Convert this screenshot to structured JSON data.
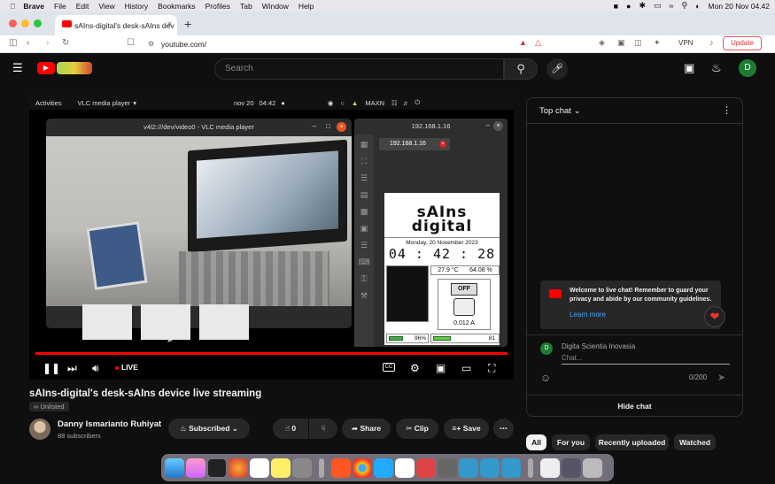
{
  "menubar": {
    "app": "Brave",
    "items": [
      "File",
      "Edit",
      "View",
      "History",
      "Bookmarks",
      "Profiles",
      "Tab",
      "Window",
      "Help"
    ],
    "clock": "Mon 20 Nov  04.42"
  },
  "browser": {
    "tab_title": "sAIns-digital's desk-sAIns dev",
    "url": "youtube.com/",
    "vpn": "VPN",
    "update": "Update"
  },
  "youtube": {
    "search_placeholder": "Search",
    "avatar_letter": "D"
  },
  "player": {
    "activities": "Activities",
    "vlc_menu": "VLC media player",
    "date": "nov 20",
    "time": "04:42",
    "maxn": "MAXN",
    "vlc_title": "v4l2:///dev/video0 - VLC media player",
    "panel_title": "192.168.1.16",
    "panel_tab": "192.168.1.16",
    "live_label": "LIVE",
    "cc_label": "CC"
  },
  "device": {
    "logo_line1": "sAIns",
    "logo_line2": "digital",
    "date": "Monday, 20 November 2023",
    "time": "04 : 42 : 28",
    "temp": "27.9 °C",
    "humidity": "64.08 %",
    "switch_label": "OFF",
    "current": "0.012 A",
    "battery": "96%",
    "signal": "81"
  },
  "video": {
    "title": "sAIns-digital's desk-sAIns device live streaming",
    "visibility": "Unlisted",
    "channel_name": "Danny Ismarianto Ruhiyat",
    "subscribers": "88 subscribers",
    "subscribed_label": "Subscribed",
    "like_count": "0",
    "share_label": "Share",
    "clip_label": "Clip",
    "save_label": "Save"
  },
  "chat": {
    "header": "Top chat",
    "welcome": "Welcome to live chat! Remember to guard your privacy and abide by our community guidelines.",
    "learn_more": "Learn more",
    "user": "Digita Scientia Inovasia",
    "user_initial": "D",
    "input_placeholder": "Chat...",
    "char_count": "0/200",
    "hide_chat": "Hide chat"
  },
  "chips": [
    "All",
    "For you",
    "Recently uploaded",
    "Watched"
  ],
  "colors": {
    "yt_red": "#ff0000",
    "link_blue": "#3ea6ff",
    "avatar_green": "#1e7b34",
    "ubuntu_orange": "#e95420"
  }
}
